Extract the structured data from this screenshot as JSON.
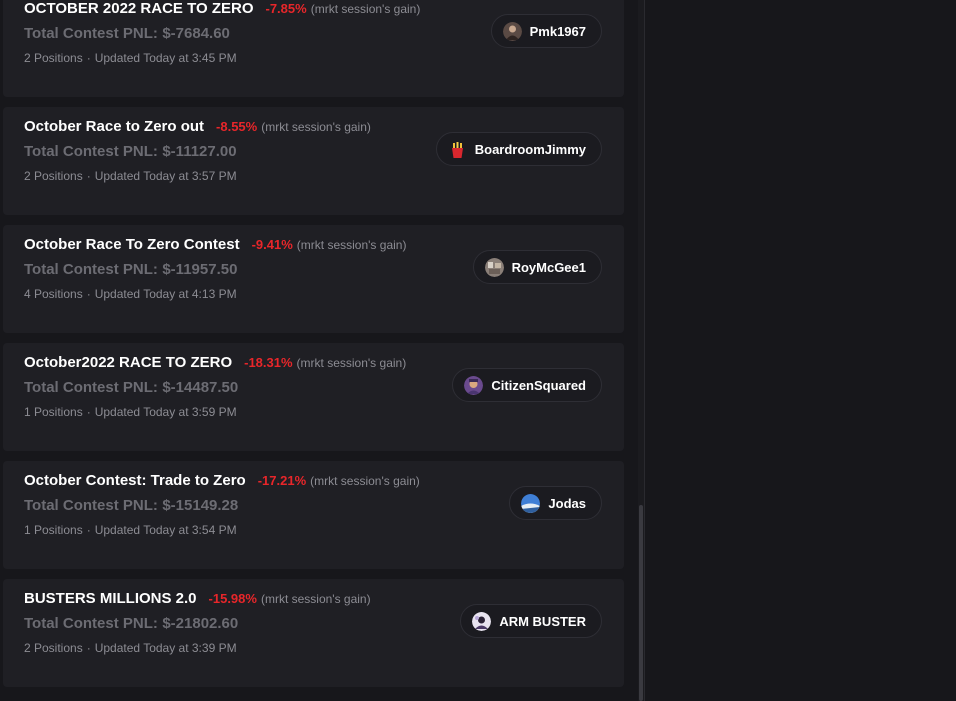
{
  "gain_suffix": "(mrkt session's gain)",
  "pnl_label": "Total Contest PNL:",
  "cards": [
    {
      "title": "OCTOBER 2022 RACE TO ZERO",
      "pct": "-7.85%",
      "pnl": "$-7684.60",
      "positions": "2 Positions",
      "updated": "Updated Today at 3:45 PM",
      "user": "Pmk1967",
      "avatar_icon": "user-avatar-icon"
    },
    {
      "title": "October Race to Zero out",
      "pct": "-8.55%",
      "pnl": "$-11127.00",
      "positions": "2 Positions",
      "updated": "Updated Today at 3:57 PM",
      "user": "BoardroomJimmy",
      "avatar_icon": "fries-avatar-icon"
    },
    {
      "title": "October Race To Zero Contest",
      "pct": "-9.41%",
      "pnl": "$-11957.50",
      "positions": "4 Positions",
      "updated": "Updated Today at 4:13 PM",
      "user": "RoyMcGee1",
      "avatar_icon": "user-avatar-icon"
    },
    {
      "title": "October2022 RACE TO ZERO",
      "pct": "-18.31%",
      "pnl": "$-14487.50",
      "positions": "1 Positions",
      "updated": "Updated Today at 3:59 PM",
      "user": "CitizenSquared",
      "avatar_icon": "user-avatar-icon"
    },
    {
      "title": "October Contest: Trade to Zero",
      "pct": "-17.21%",
      "pnl": "$-15149.28",
      "positions": "1 Positions",
      "updated": "Updated Today at 3:54 PM",
      "user": "Jodas",
      "avatar_icon": "landscape-avatar-icon"
    },
    {
      "title": "BUSTERS MILLIONS 2.0",
      "pct": "-15.98%",
      "pnl": "$-21802.60",
      "positions": "2 Positions",
      "updated": "Updated Today at 3:39 PM",
      "user": "ARM BUSTER",
      "avatar_icon": "user-avatar-icon"
    }
  ],
  "colors": {
    "negative": "#e8262a",
    "card_bg": "#1f1f24",
    "page_bg": "#17171b"
  }
}
